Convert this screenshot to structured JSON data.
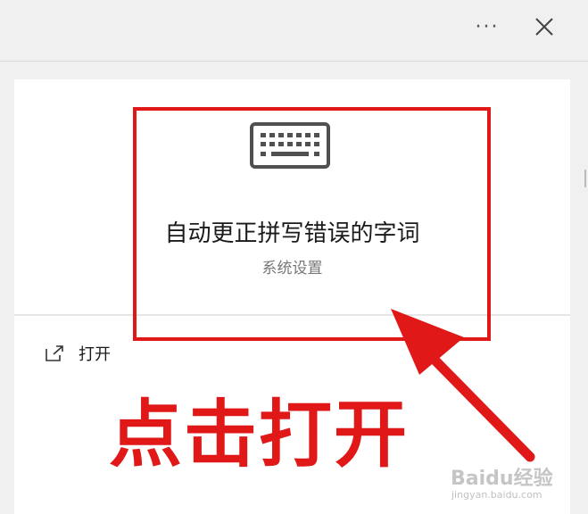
{
  "titlebar": {
    "more_icon": "more-horizontal-icon",
    "more_label": "···",
    "close_icon": "close-icon"
  },
  "result": {
    "icon": "keyboard-icon",
    "title": "自动更正拼写错误的字词",
    "subtitle": "系统设置"
  },
  "actions": {
    "open_icon": "open-external-icon",
    "open_label": "打开"
  },
  "annotation": {
    "text": "点击打开",
    "color": "#e01818"
  },
  "watermark": {
    "brand": "Baidu经验",
    "url": "jingyan.baidu.com"
  }
}
